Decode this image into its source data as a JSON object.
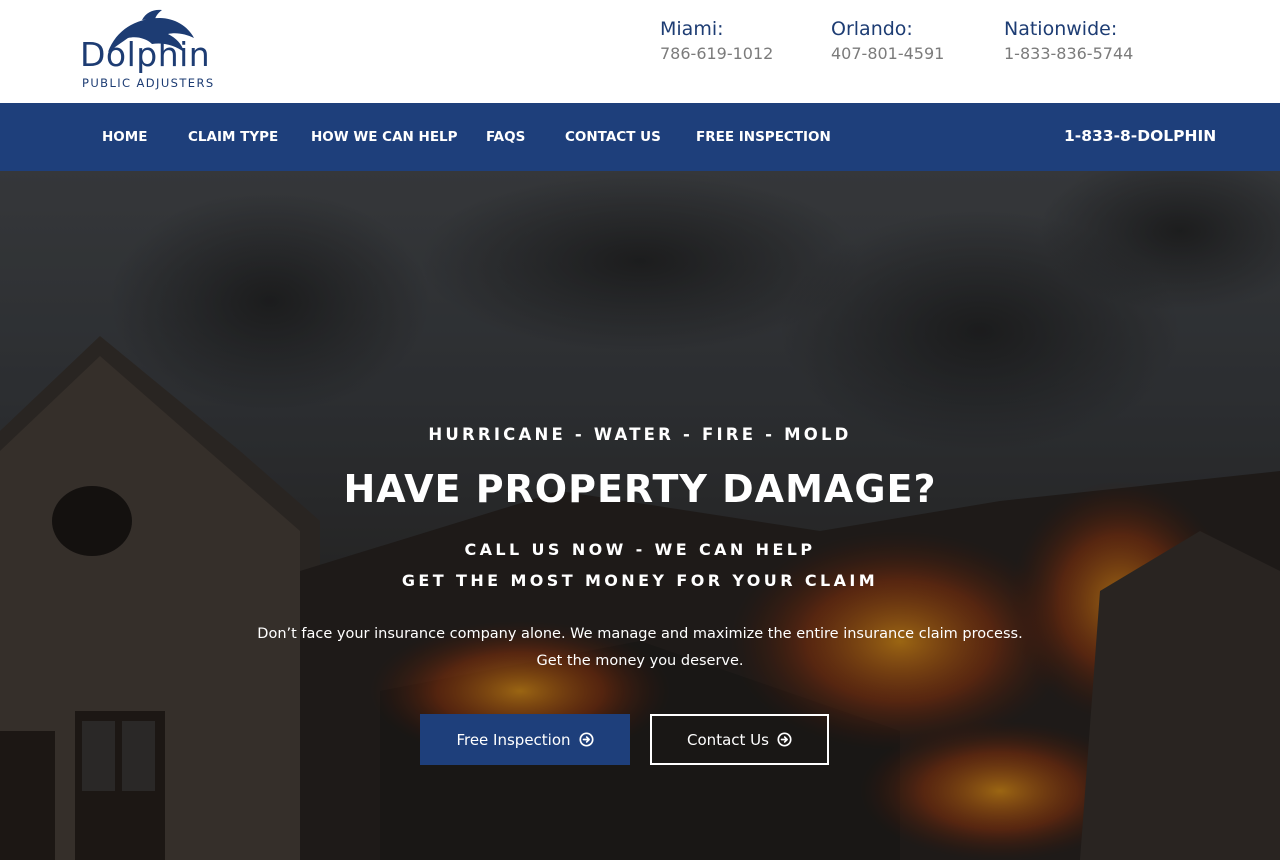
{
  "logo": {
    "wordmark": "Dolphin",
    "tagline": "PUBLIC ADJUSTERS"
  },
  "offices": [
    {
      "city": "Miami:",
      "phone": "786-619-1012"
    },
    {
      "city": "Orlando:",
      "phone": "407-801-4591"
    },
    {
      "city": "Nationwide:",
      "phone": "1-833-836-5744"
    }
  ],
  "nav": {
    "items": [
      {
        "label": "HOME"
      },
      {
        "label": "CLAIM TYPE"
      },
      {
        "label": "HOW WE CAN HELP"
      },
      {
        "label": "FAQS"
      },
      {
        "label": "CONTACT US"
      },
      {
        "label": "FREE INSPECTION"
      }
    ],
    "phone": "1-833-8-DOLPHIN"
  },
  "hero": {
    "tags": "HURRICANE - WATER - FIRE - MOLD",
    "title": "HAVE PROPERTY DAMAGE?",
    "subtitle_line1": "CALL US NOW - WE CAN HELP",
    "subtitle_line2": "GET THE MOST MONEY FOR YOUR CLAIM",
    "description": "Don’t face your insurance company alone. We manage and maximize the entire insurance claim process. Get the money you deserve.",
    "primary_button": "Free Inspection",
    "secondary_button": "Contact Us",
    "button_icon": "arrow-circle-right-icon"
  },
  "colors": {
    "brand_navy": "#1e3f7b",
    "logo_navy": "#1d3c73",
    "phone_gray": "#7b7b7b",
    "white": "#ffffff"
  }
}
